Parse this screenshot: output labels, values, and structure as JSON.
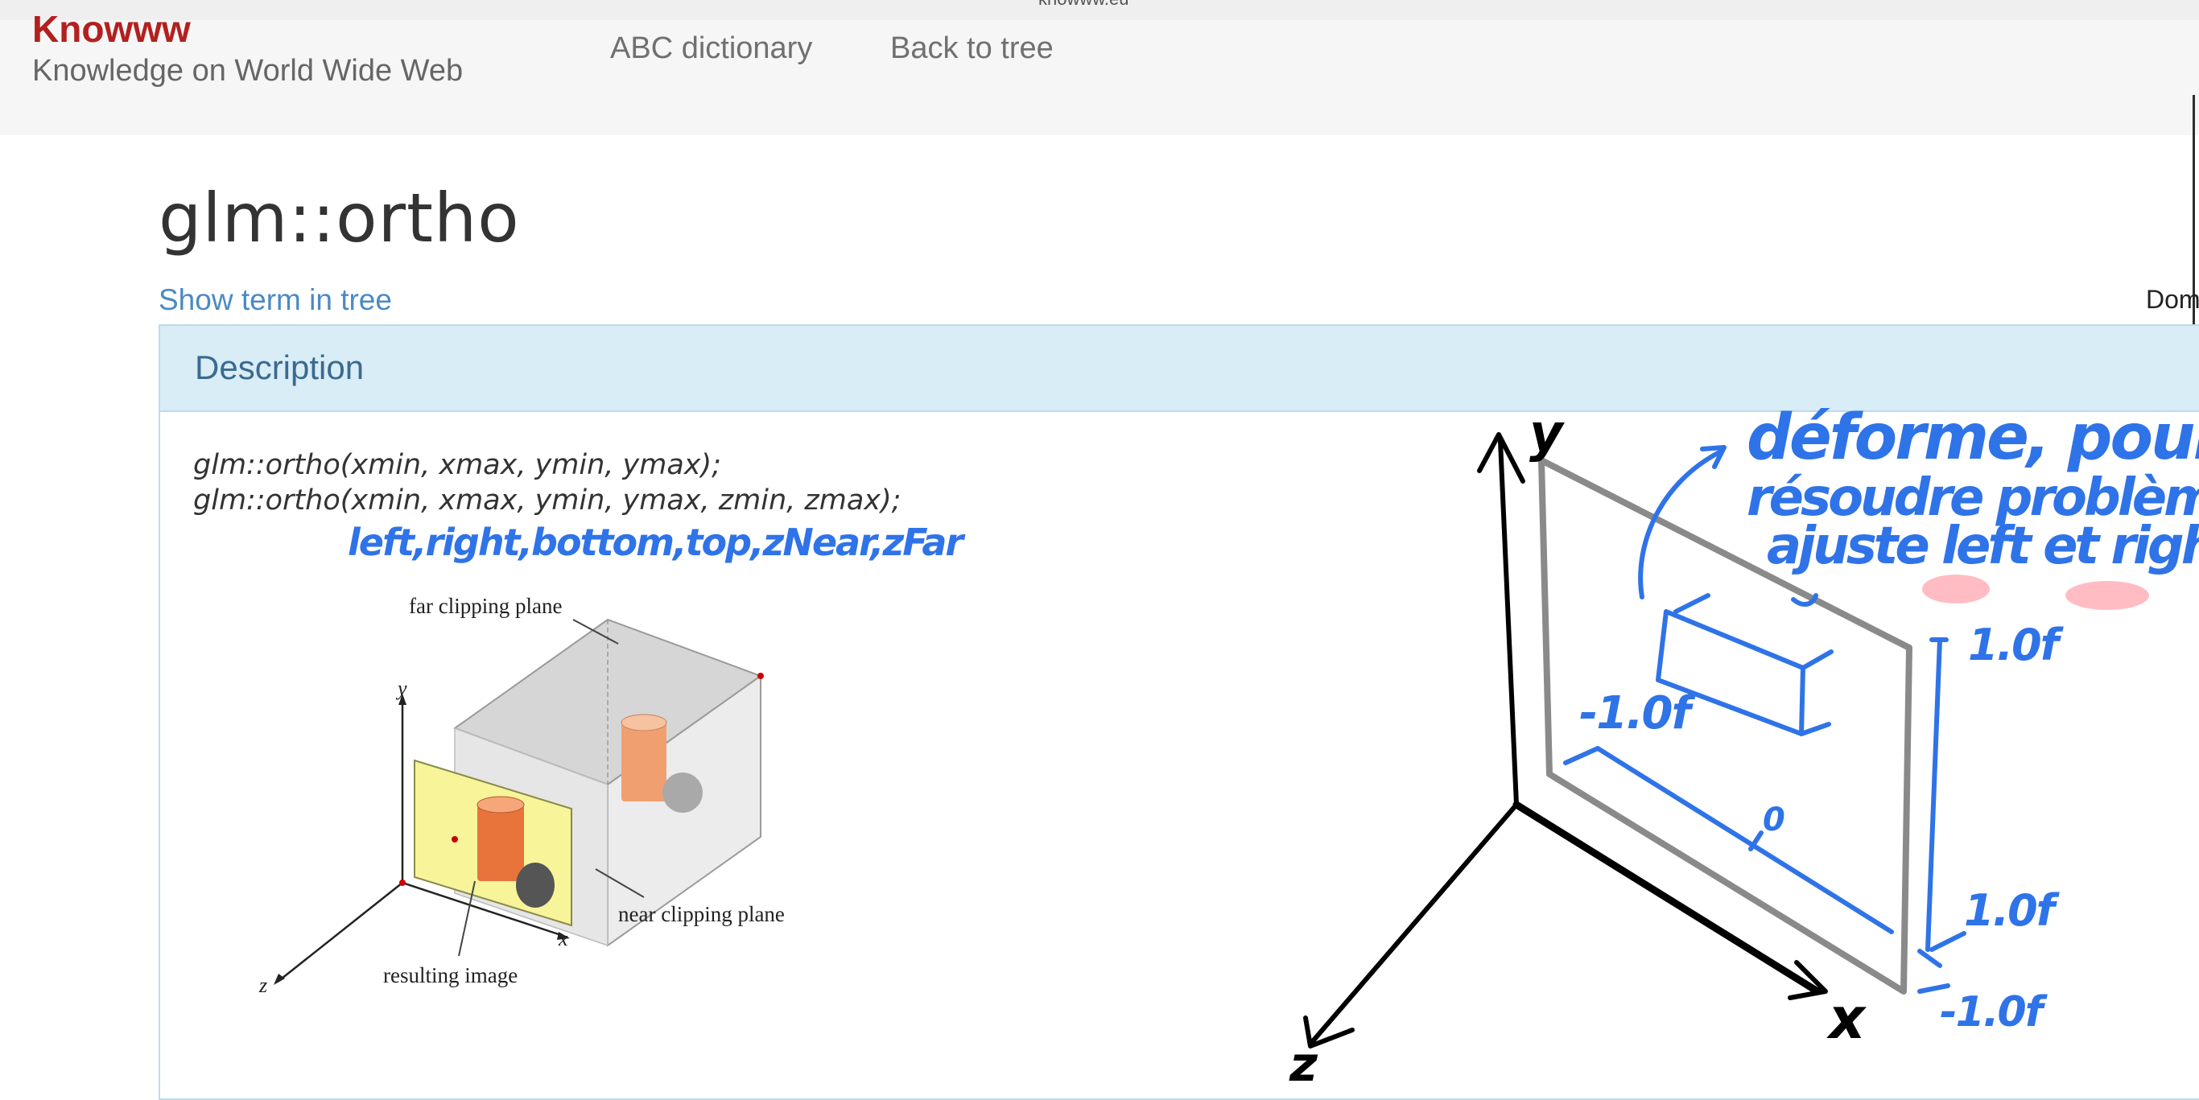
{
  "browser": {
    "url_fragment": "knowww.eu"
  },
  "site": {
    "brand": "Knowww",
    "tagline": "Knowledge on World Wide Web",
    "nav": [
      "ABC dictionary",
      "Back to tree"
    ]
  },
  "page": {
    "title": "glm::ortho",
    "show_term_link": "Show term in tree",
    "domain_cut": "Dom"
  },
  "description": {
    "heading": "Description",
    "signatures": [
      "glm::ortho(xmin, xmax, ymin, ymax);",
      "glm::ortho(xmin, xmax, ymin, ymax, zmin, zmax);"
    ],
    "handwritten_params": "left,right,bottom,top,zNear,zFar"
  },
  "figure": {
    "labels": {
      "far_plane": "far clipping plane",
      "near_plane": "near clipping plane",
      "result": "resulting image",
      "x": "x",
      "y": "y",
      "z": "z"
    }
  },
  "annotation": {
    "axis_y": "y",
    "axis_x": "x",
    "axis_z": "z",
    "note_line1": "déforme, pour",
    "note_line2": "résoudre problème:",
    "note_line3": "ajuste left et right.",
    "val_top": "1.0f",
    "val_left": "-1.0f",
    "val_center": "0",
    "val_right": "1.0f",
    "val_bottom": "-1.0f"
  },
  "colors": {
    "brand_red": "#b2211f",
    "link_blue": "#4a8ac4",
    "panel_heading_bg": "#d9edf7",
    "ink_blue": "#2f73e8"
  }
}
